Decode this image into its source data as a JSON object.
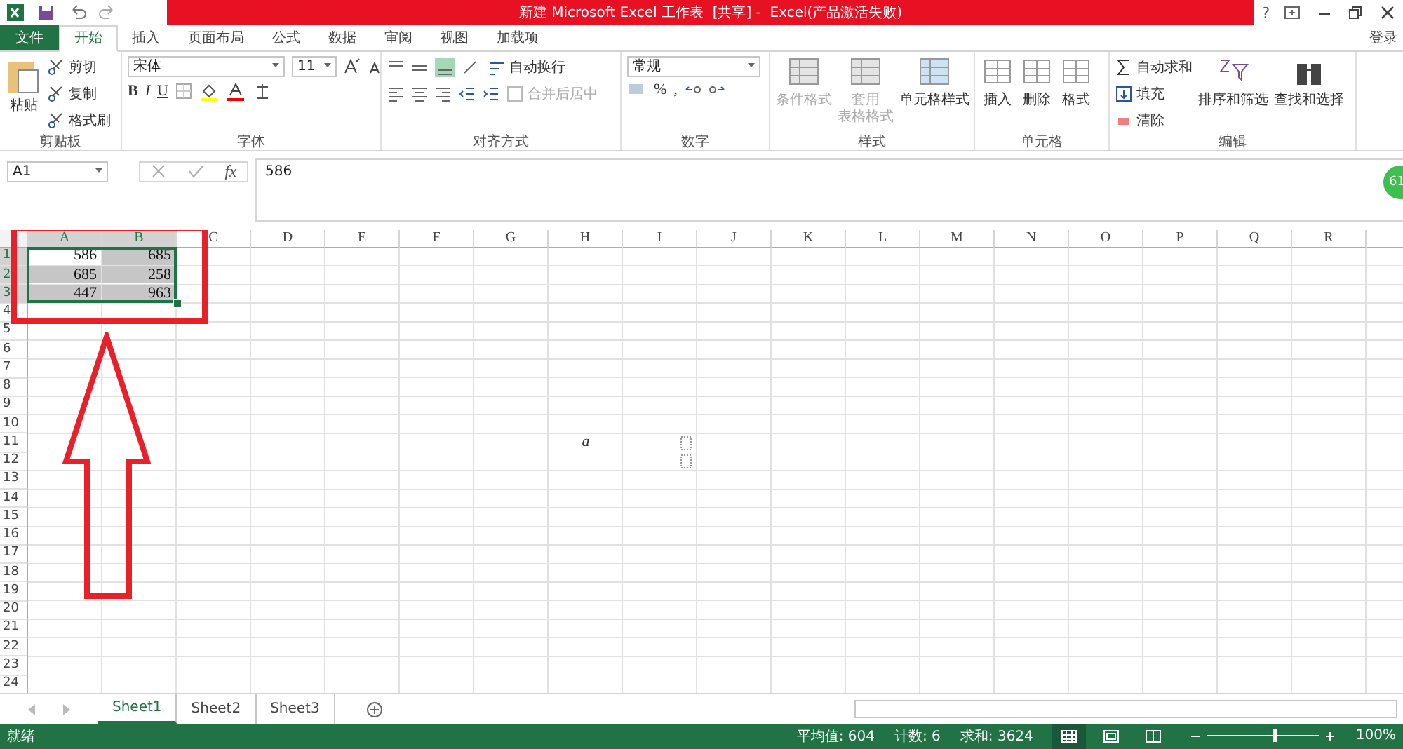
{
  "title_bar": {
    "title": "新建 Microsoft Excel 工作表  [共享] -  Excel(产品激活失败)",
    "help": "?",
    "account": "登录"
  },
  "tabs": [
    {
      "label": "文件",
      "kind": "file",
      "selected": false
    },
    {
      "label": "开始",
      "kind": "tab",
      "selected": true
    },
    {
      "label": "插入",
      "kind": "tab",
      "selected": false
    },
    {
      "label": "页面布局",
      "kind": "tab",
      "selected": false
    },
    {
      "label": "公式",
      "kind": "tab",
      "selected": false
    },
    {
      "label": "数据",
      "kind": "tab",
      "selected": false
    },
    {
      "label": "审阅",
      "kind": "tab",
      "selected": false
    },
    {
      "label": "视图",
      "kind": "tab",
      "selected": false
    },
    {
      "label": "加载项",
      "kind": "tab",
      "selected": false
    }
  ],
  "clipboard": {
    "label": "剪贴板",
    "paste": "粘贴",
    "items": [
      "剪切",
      "复制",
      "格式刷"
    ]
  },
  "font": {
    "label": "字体",
    "name": "宋体",
    "size": "11",
    "buttons": [
      "B",
      "I",
      "U"
    ]
  },
  "alignment": {
    "label": "对齐方式",
    "wrap": {
      "label": "自动换行",
      "disabled": false
    },
    "merge": {
      "label": "合并后居中",
      "disabled": true
    }
  },
  "number": {
    "label": "数字",
    "format": "常规",
    "buttons": [
      "%",
      ","
    ]
  },
  "styles": {
    "label": "样式",
    "items": [
      {
        "lines": [
          "条件格式"
        ],
        "disabled": true
      },
      {
        "lines": [
          "套用",
          "表格格式"
        ],
        "disabled": true
      },
      {
        "lines": [
          "单元格样式"
        ],
        "disabled": false
      }
    ]
  },
  "cells": {
    "label": "单元格",
    "items": [
      "插入",
      "删除",
      "格式"
    ]
  },
  "editing": {
    "label": "编辑",
    "small": [
      "自动求和",
      "填充",
      "清除"
    ],
    "large": [
      "排序和筛选",
      "查找和选择"
    ]
  },
  "formula_bar": {
    "name_box": "A1",
    "function_label": "fx",
    "value": "586"
  },
  "badge": "61",
  "grid": {
    "columns": [
      {
        "label": "A",
        "selected": true
      },
      {
        "label": "B",
        "selected": true
      },
      {
        "label": "C",
        "selected": false
      },
      {
        "label": "D",
        "selected": false
      },
      {
        "label": "E",
        "selected": false
      },
      {
        "label": "F",
        "selected": false
      },
      {
        "label": "G",
        "selected": false
      },
      {
        "label": "H",
        "selected": false
      },
      {
        "label": "I",
        "selected": false
      },
      {
        "label": "J",
        "selected": false
      },
      {
        "label": "K",
        "selected": false
      },
      {
        "label": "L",
        "selected": false
      },
      {
        "label": "M",
        "selected": false
      },
      {
        "label": "N",
        "selected": false
      },
      {
        "label": "O",
        "selected": false
      },
      {
        "label": "P",
        "selected": false
      },
      {
        "label": "Q",
        "selected": false
      },
      {
        "label": "R",
        "selected": false
      }
    ],
    "rows": [
      {
        "label": "1",
        "selected": true,
        "cells": [
          {
            "kind": "number",
            "value": "586",
            "selected": false
          },
          {
            "kind": "number",
            "value": "685",
            "selected": true
          }
        ]
      },
      {
        "label": "2",
        "selected": true,
        "cells": [
          {
            "kind": "number",
            "value": "685",
            "selected": true
          },
          {
            "kind": "number",
            "value": "258",
            "selected": true
          }
        ]
      },
      {
        "label": "3",
        "selected": true,
        "cells": [
          {
            "kind": "number",
            "value": "447",
            "selected": true
          },
          {
            "kind": "number",
            "value": "963",
            "selected": true
          }
        ]
      },
      {
        "label": "4",
        "selected": false
      },
      {
        "label": "5",
        "selected": false
      },
      {
        "label": "6",
        "selected": false
      },
      {
        "label": "7",
        "selected": false
      },
      {
        "label": "8",
        "selected": false
      },
      {
        "label": "9",
        "selected": false
      },
      {
        "label": "10",
        "selected": false
      },
      {
        "label": "11",
        "selected": false,
        "cells": [
          {
            "kind": "empty"
          },
          {
            "kind": "empty"
          },
          {
            "kind": "empty"
          },
          {
            "kind": "empty"
          },
          {
            "kind": "empty"
          },
          {
            "kind": "empty"
          },
          {
            "kind": "empty"
          },
          {
            "kind": "text",
            "value": "a"
          },
          {
            "kind": "box"
          }
        ]
      },
      {
        "label": "12",
        "selected": false,
        "cells": [
          {
            "kind": "empty"
          },
          {
            "kind": "empty"
          },
          {
            "kind": "empty"
          },
          {
            "kind": "empty"
          },
          {
            "kind": "empty"
          },
          {
            "kind": "empty"
          },
          {
            "kind": "empty"
          },
          {
            "kind": "empty"
          },
          {
            "kind": "box"
          }
        ]
      },
      {
        "label": "13",
        "selected": false
      },
      {
        "label": "14",
        "selected": false
      },
      {
        "label": "15",
        "selected": false
      },
      {
        "label": "16",
        "selected": false
      },
      {
        "label": "17",
        "selected": false
      },
      {
        "label": "18",
        "selected": false
      },
      {
        "label": "19",
        "selected": false
      },
      {
        "label": "20",
        "selected": false
      },
      {
        "label": "21",
        "selected": false
      },
      {
        "label": "22",
        "selected": false
      },
      {
        "label": "23",
        "selected": false
      },
      {
        "label": "24",
        "selected": false
      }
    ]
  },
  "sheets": [
    {
      "label": "Sheet1",
      "selected": true
    },
    {
      "label": "Sheet2",
      "selected": false
    },
    {
      "label": "Sheet3",
      "selected": false
    }
  ],
  "status_bar": {
    "status": "就绪",
    "average": "平均值: 604",
    "count": "计数: 6",
    "sum": "求和: 3624",
    "views": [
      {
        "kind": "normal",
        "selected": true
      },
      {
        "kind": "layout",
        "selected": false
      },
      {
        "kind": "break",
        "selected": false
      }
    ],
    "zoom": {
      "level": 0.6,
      "label": "100%"
    }
  }
}
